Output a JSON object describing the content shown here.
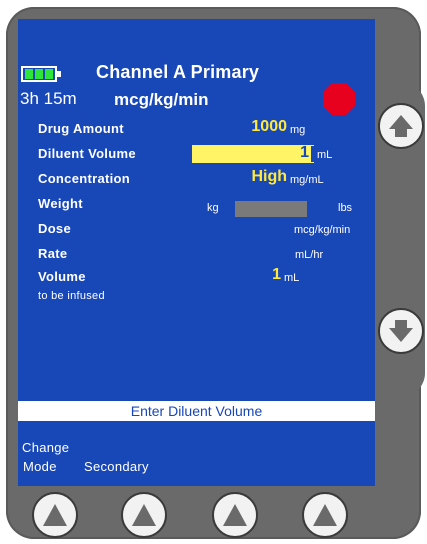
{
  "header": {
    "channel_title": "Channel A Primary",
    "time_remaining": "3h 15m",
    "dose_units": "mcg/kg/min"
  },
  "fields": {
    "drug_amount": {
      "label": "Drug Amount",
      "value": "1000",
      "unit": "mg"
    },
    "diluent_volume": {
      "label": "Diluent Volume",
      "value": "1",
      "unit": "mL"
    },
    "concentration": {
      "label": "Concentration",
      "value": "High",
      "unit": "mg/mL"
    },
    "weight": {
      "label": "Weight",
      "unit_left": "kg",
      "unit_right": "lbs"
    },
    "dose": {
      "label": "Dose",
      "unit": "mcg/kg/min"
    },
    "rate": {
      "label": "Rate",
      "unit": "mL/hr"
    },
    "volume": {
      "label": "Volume",
      "sublabel": "to be infused",
      "value": "1",
      "unit": "mL"
    }
  },
  "prompt": "Enter Diluent Volume",
  "softkeys": {
    "key1_line1": "Change",
    "key1_line2": "Mode",
    "key2": "Secondary"
  },
  "icons": {
    "battery": "battery-icon",
    "stop": "stop-octagon-icon",
    "up_arrow": "up-arrow-icon",
    "down_arrow": "down-arrow-icon"
  },
  "colors": {
    "screen": "#1847b8",
    "value": "#ffe93a",
    "highlight": "#fff466",
    "battery": "#2ee63a",
    "stop": "#e8001f",
    "housing": "#6a6a6a"
  }
}
